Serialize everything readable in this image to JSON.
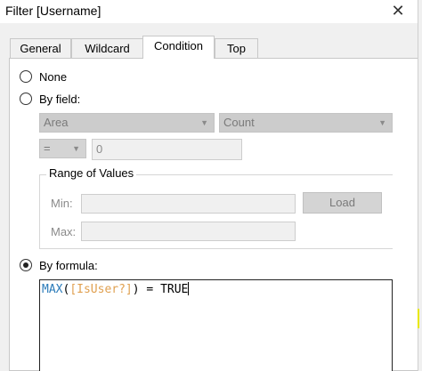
{
  "window": {
    "title": "Filter [Username]"
  },
  "tabs": [
    {
      "label": "General",
      "active": false
    },
    {
      "label": "Wildcard",
      "active": false
    },
    {
      "label": "Condition",
      "active": true
    },
    {
      "label": "Top",
      "active": false
    }
  ],
  "condition": {
    "none_label": "None",
    "by_field_label": "By field:",
    "field_select": "Area",
    "aggregation_select": "Count",
    "operator_select": "=",
    "value": "0",
    "range_label": "Range of Values",
    "min_label": "Min:",
    "max_label": "Max:",
    "load_label": "Load",
    "by_formula_label": "By formula:",
    "selected": "by_formula"
  },
  "formula": {
    "fn": "MAX",
    "open": "(",
    "field": "[IsUser?]",
    "close": ")",
    "rest": " = TRUE"
  },
  "colors": {
    "function": "#2b7bb9",
    "field": "#e0a050",
    "highlight_mark": "#e8e800"
  }
}
